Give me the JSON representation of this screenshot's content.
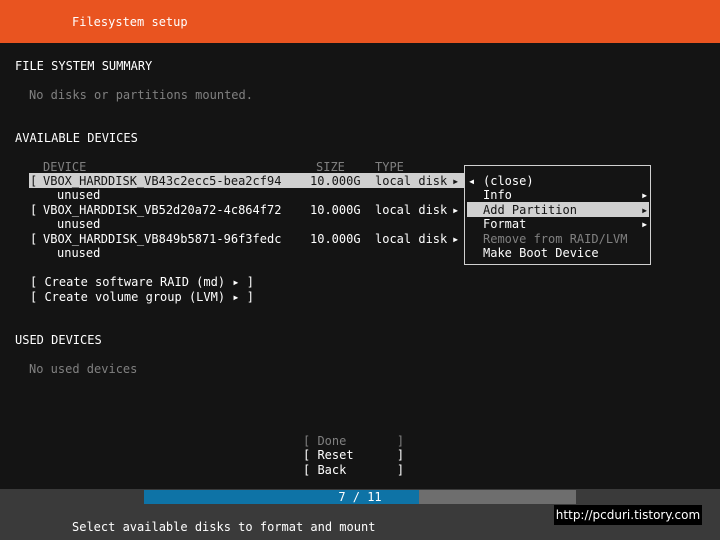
{
  "header": {
    "title": "Filesystem setup"
  },
  "summary": {
    "title": "FILE SYSTEM SUMMARY",
    "empty_text": "No disks or partitions mounted."
  },
  "available": {
    "title": "AVAILABLE DEVICES",
    "columns": {
      "device": "DEVICE",
      "size": "SIZE",
      "type": "TYPE"
    },
    "devices": [
      {
        "bracket": "[",
        "name": "VBOX_HARDDISK_VB43c2ecc5-bea2cf94",
        "size": "10.000G",
        "type": "local disk",
        "arrow": "▸",
        "status": "unused"
      },
      {
        "bracket": "[",
        "name": "VBOX_HARDDISK_VB52d20a72-4c864f72",
        "size": "10.000G",
        "type": "local disk",
        "arrow": "▸",
        "status": "unused"
      },
      {
        "bracket": "[",
        "name": "VBOX_HARDDISK_VB849b5871-96f3fedc",
        "size": "10.000G",
        "type": "local disk",
        "arrow": "▸",
        "status": "unused"
      }
    ],
    "create_raid": "[ Create software RAID (md) ▸ ]",
    "create_lvm": "[ Create volume group (LVM) ▸ ]"
  },
  "context_menu": {
    "items": [
      {
        "prefix": "◂",
        "label": "(close)",
        "arrow": "",
        "enabled": true
      },
      {
        "prefix": "",
        "label": "Info",
        "arrow": "▸",
        "enabled": true
      },
      {
        "prefix": "",
        "label": "Add Partition",
        "arrow": "▸",
        "enabled": true,
        "selected": true
      },
      {
        "prefix": "",
        "label": "Format",
        "arrow": "▸",
        "enabled": true
      },
      {
        "prefix": "",
        "label": "Remove from RAID/LVM",
        "arrow": "",
        "enabled": false
      },
      {
        "prefix": "",
        "label": "Make Boot Device",
        "arrow": "",
        "enabled": true
      }
    ]
  },
  "used": {
    "title": "USED DEVICES",
    "empty_text": "No used devices"
  },
  "buttons": {
    "done": "[ Done       ]",
    "reset": "[ Reset      ]",
    "back": "[ Back       ]"
  },
  "progress": {
    "label": "7 / 11",
    "current": 7,
    "total": 11
  },
  "footer": {
    "hint": "Select available disks to format and mount",
    "watermark": "http://pcduri.tistory.com"
  },
  "colors": {
    "header_bg": "#e95420",
    "background": "#141414",
    "progress_fill": "#0e73a6",
    "highlight_bg": "#d0d0d0"
  }
}
